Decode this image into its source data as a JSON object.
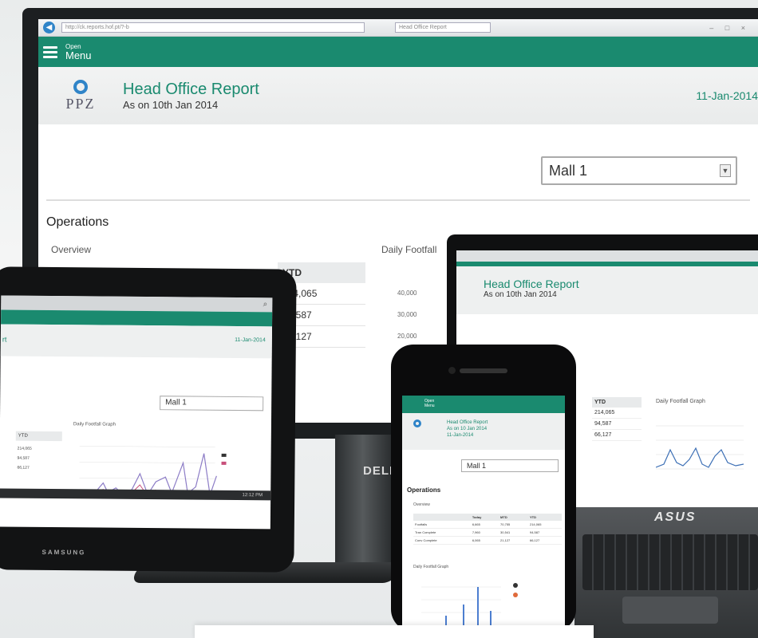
{
  "colors": {
    "accent": "#1a8a6f",
    "logo_blue": "#2f84c8",
    "device": "#121314"
  },
  "desktop": {
    "browser": {
      "address": "http://ck.reports.hof.pt/?-b",
      "tab": "Head Office Report",
      "controls": "– □ ×"
    },
    "header": {
      "open_label": "Open",
      "menu_label": "Menu",
      "icon": "hamburger-icon"
    },
    "logo_text": "PPZ",
    "report": {
      "title": "Head Office Report",
      "subtitle": "As on 10th Jan 2014",
      "date": "11-Jan-2014"
    },
    "mall_select": {
      "value": "Mall 1"
    },
    "operations": {
      "title": "Operations",
      "overview_label": "Overview",
      "footfall_label": "Daily Footfall"
    },
    "ytd_table": {
      "header": "YTD",
      "rows": [
        "214,065",
        "94,587",
        "66,127"
      ]
    },
    "y_ticks": [
      "40,000",
      "30,000",
      "20,000"
    ]
  },
  "tablet": {
    "report_label": "rt",
    "date": "11-Jan-2014",
    "mall_select": "Mall 1",
    "ytd_header": "YTD",
    "ytd_rows": [
      "214,065",
      "94,587",
      "66,127"
    ],
    "footfall_label": "Daily Footfall Graph",
    "brand": "SAMSUNG",
    "status": "12:12 PM"
  },
  "laptop": {
    "report": {
      "title": "Head Office Report",
      "subtitle": "As on 10th Jan 2014"
    },
    "ytd_header": "YTD",
    "ytd_rows": [
      "214,065",
      "94,587",
      "66,127"
    ],
    "footfall_label": "Daily Footfall Graph",
    "brand": "ASUS"
  },
  "monitor_brand": "DELL",
  "phone": {
    "header": {
      "open_label": "Open",
      "menu_label": "Menu"
    },
    "report": {
      "title": "Head Office Report",
      "subtitle": "As on 10 Jan 2014",
      "date": "11-Jan-2014"
    },
    "mall_select": "Mall 1",
    "operations_title": "Operations",
    "overview_label": "Overview",
    "table": {
      "columns": [
        "",
        "Today",
        "MTD",
        "YTD"
      ],
      "rows": [
        [
          "Footfalls",
          "6,665",
          "70,755",
          "214,065"
        ],
        [
          "Tran Complete",
          "7,960",
          "30,541",
          "94,587"
        ],
        [
          "Conv Complete",
          "6,065",
          "21,127",
          "66,127"
        ]
      ]
    },
    "footfall_label": "Daily Footfall Graph"
  }
}
